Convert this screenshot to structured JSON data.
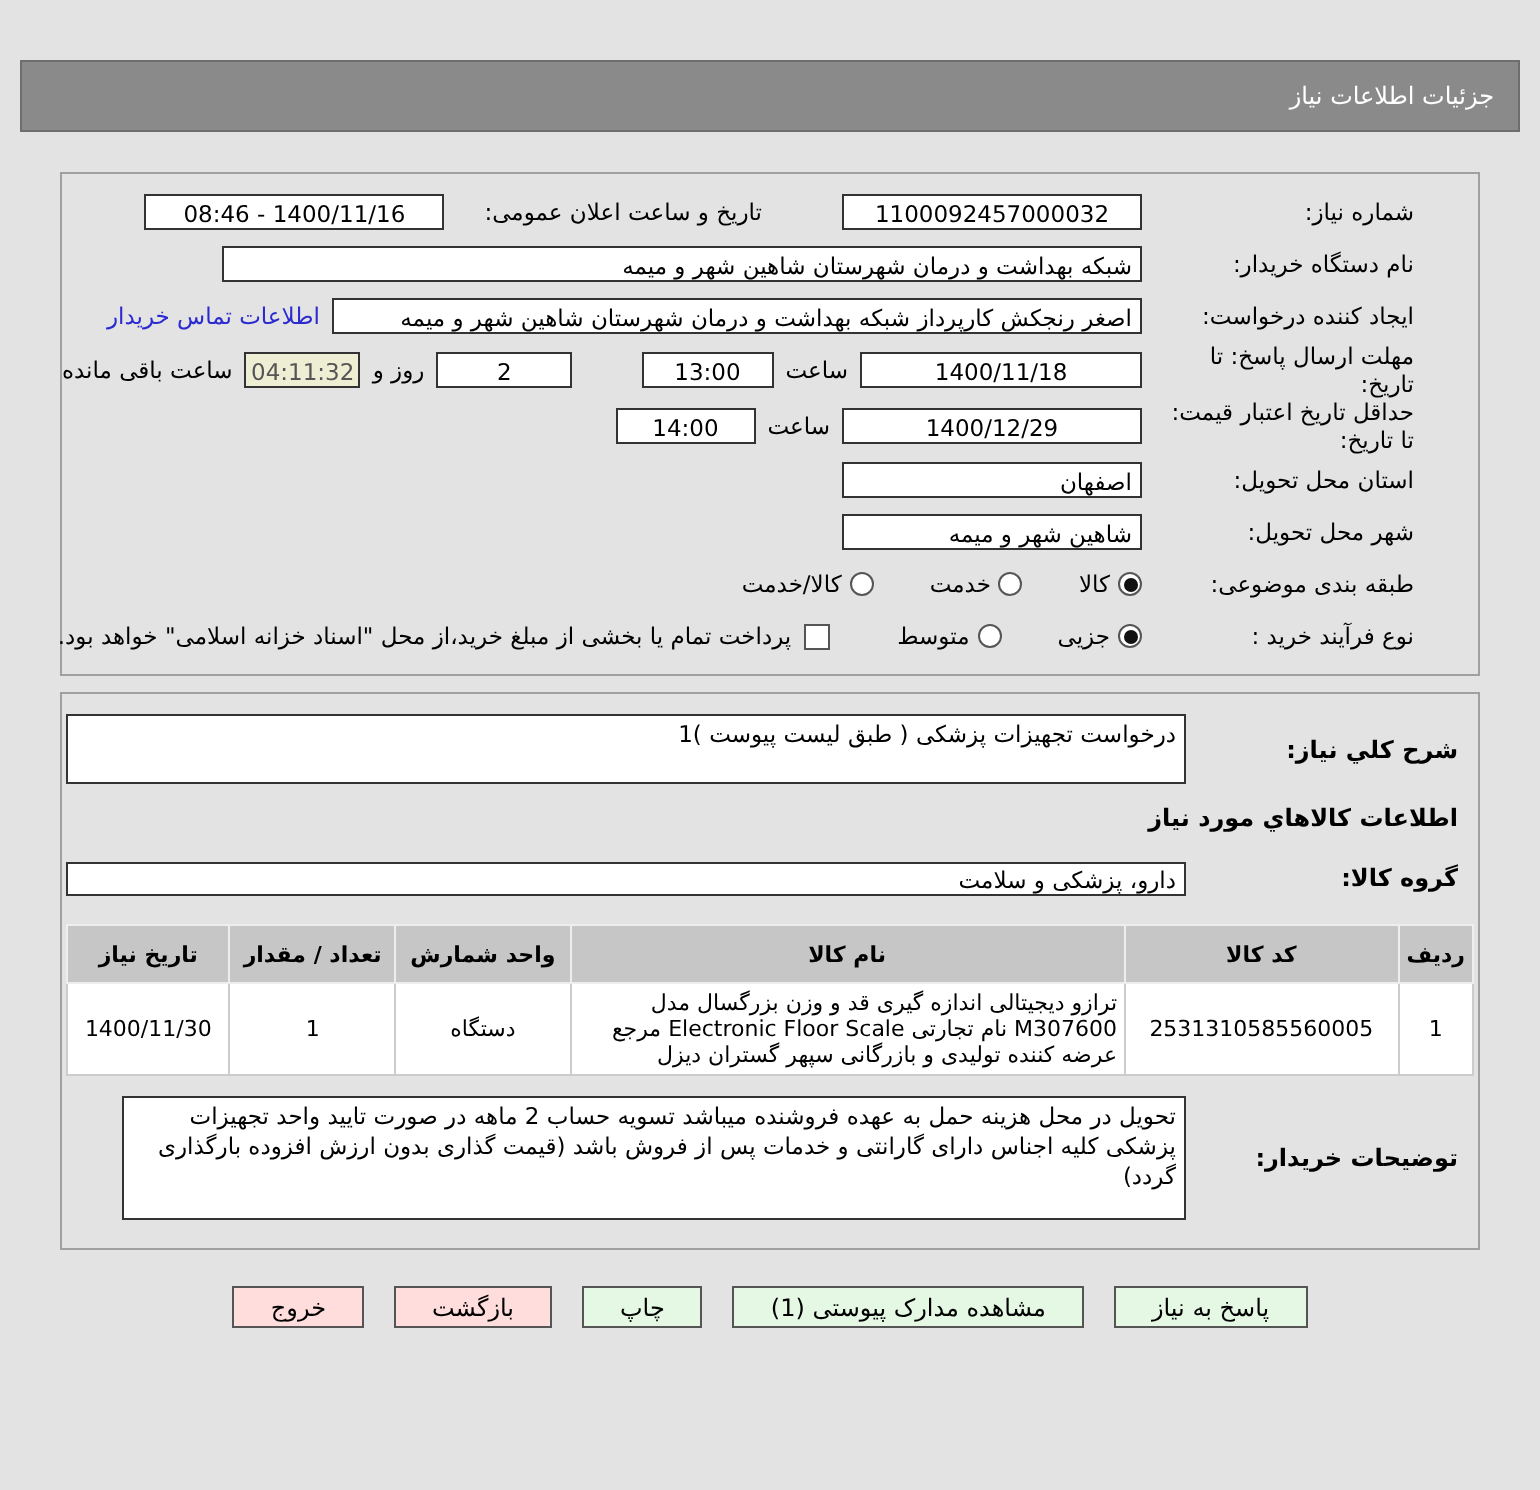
{
  "header": {
    "title": "جزئیات اطلاعات نیاز"
  },
  "details": {
    "need_number": {
      "label": "شماره نیاز:",
      "value": "1100092457000032"
    },
    "announce": {
      "label": "تاریخ و ساعت اعلان عمومی:",
      "value": "1400/11/16 - 08:46"
    },
    "buyer": {
      "label": "نام دستگاه خریدار:",
      "value": "شبکه بهداشت و درمان شهرستان شاهین شهر و میمه"
    },
    "requester": {
      "label": "ایجاد کننده درخواست:",
      "value": "اصغر رنجکش کارپرداز شبکه بهداشت و درمان شهرستان شاهین شهر و میمه",
      "link": "اطلاعات تماس خریدار"
    },
    "deadline": {
      "label": "مهلت ارسال پاسخ: تا تاریخ:",
      "date": "1400/11/18",
      "time_label": "ساعت",
      "time": "13:00",
      "days": "2",
      "days_label": "روز و",
      "remaining": "04:11:32",
      "remaining_label": "ساعت باقی مانده"
    },
    "validity": {
      "label": "حداقل تاریخ اعتبار قیمت: تا تاریخ:",
      "date": "1400/12/29",
      "time_label": "ساعت",
      "time": "14:00"
    },
    "province": {
      "label": "استان محل تحویل:",
      "value": "اصفهان"
    },
    "city": {
      "label": "شهر محل تحویل:",
      "value": "شاهین شهر و میمه"
    },
    "category": {
      "label": "طبقه بندی موضوعی:",
      "options": [
        {
          "label": "کالا",
          "selected": true
        },
        {
          "label": "خدمت",
          "selected": false
        },
        {
          "label": "کالا/خدمت",
          "selected": false
        }
      ]
    },
    "process": {
      "label": "نوع فرآیند خرید :",
      "options": [
        {
          "label": "جزیی",
          "selected": true
        },
        {
          "label": "متوسط",
          "selected": false
        }
      ],
      "payment": {
        "label": "پرداخت تمام یا بخشی از مبلغ خرید،از محل \"اسناد خزانه اسلامی\" خواهد بود.",
        "checked": false
      }
    }
  },
  "items": {
    "summary": {
      "label": "شرح كلي نياز:",
      "value": "درخواست تجهیزات پزشکی ( طبق لیست پیوست )1"
    },
    "section_title": "اطلاعات كالاهاي مورد نياز",
    "group": {
      "label": "گروه کالا:",
      "value": "دارو، پزشکی و سلامت"
    },
    "table": {
      "columns": [
        "ردیف",
        "کد کالا",
        "نام کالا",
        "واحد شمارش",
        "تعداد / مقدار",
        "تاریخ نیاز"
      ],
      "rows": [
        {
          "cells": [
            "1",
            "2531310585560005",
            "ترازو دیجیتالی اندازه گیری قد و وزن بزرگسال مدل M307600 نام تجارتی Electronic Floor Scale مرجع عرضه کننده تولیدی و بازرگانی سپهر گستران دیزل",
            "دستگاه",
            "1",
            "1400/11/30"
          ]
        }
      ]
    },
    "notes": {
      "label": "توضیحات خریدار:",
      "value": "تحویل در محل هزینه حمل به عهده فروشنده میباشد تسویه حساب 2 ماهه در صورت تایید واحد تجهیزات پزشکی کلیه اجناس دارای گارانتی و خدمات پس از فروش باشد (قیمت گذاری بدون ارزش افزوده بارگذاری گردد)"
    }
  },
  "buttons": [
    {
      "label": "پاسخ به نیاز",
      "kind": "primary"
    },
    {
      "label": "مشاهده مدارک پیوستی (1)",
      "kind": "primary"
    },
    {
      "label": "چاپ",
      "kind": "primary"
    },
    {
      "label": "بازگشت",
      "kind": "danger"
    },
    {
      "label": "خروج",
      "kind": "danger"
    }
  ]
}
